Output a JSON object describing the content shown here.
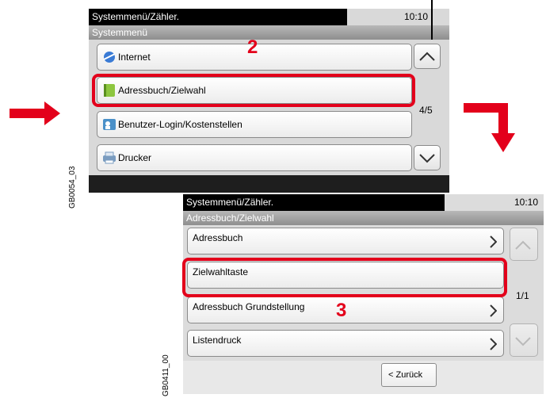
{
  "screen1": {
    "title": "Systemmenü/Zähler.",
    "time": "10:10",
    "subtitle": "Systemmenü",
    "items": [
      {
        "label": "Internet",
        "icon": "internet-icon"
      },
      {
        "label": "Adressbuch/Zielwahl",
        "icon": "addressbook-icon"
      },
      {
        "label": "Benutzer-Login/Kostenstellen",
        "icon": "user-login-icon"
      },
      {
        "label": "Drucker",
        "icon": "printer-icon"
      }
    ],
    "page_indicator": "4/5",
    "step": "2",
    "image_code": "GB0054_03"
  },
  "screen2": {
    "title": "Systemmenü/Zähler.",
    "time": "10:10",
    "subtitle": "Adressbuch/Zielwahl",
    "items": [
      {
        "label": "Adressbuch"
      },
      {
        "label": "Zielwahltaste"
      },
      {
        "label": "Adressbuch Grundstellung"
      },
      {
        "label": "Listendruck"
      }
    ],
    "page_indicator": "1/1",
    "back_label": "< Zurück",
    "step": "3",
    "image_code": "GB0411_00"
  },
  "colors": {
    "highlight": "#e3001b",
    "titlebar": "#000000",
    "subbar": "#9c9c9c",
    "screen_bg": "#d9d9d9"
  }
}
